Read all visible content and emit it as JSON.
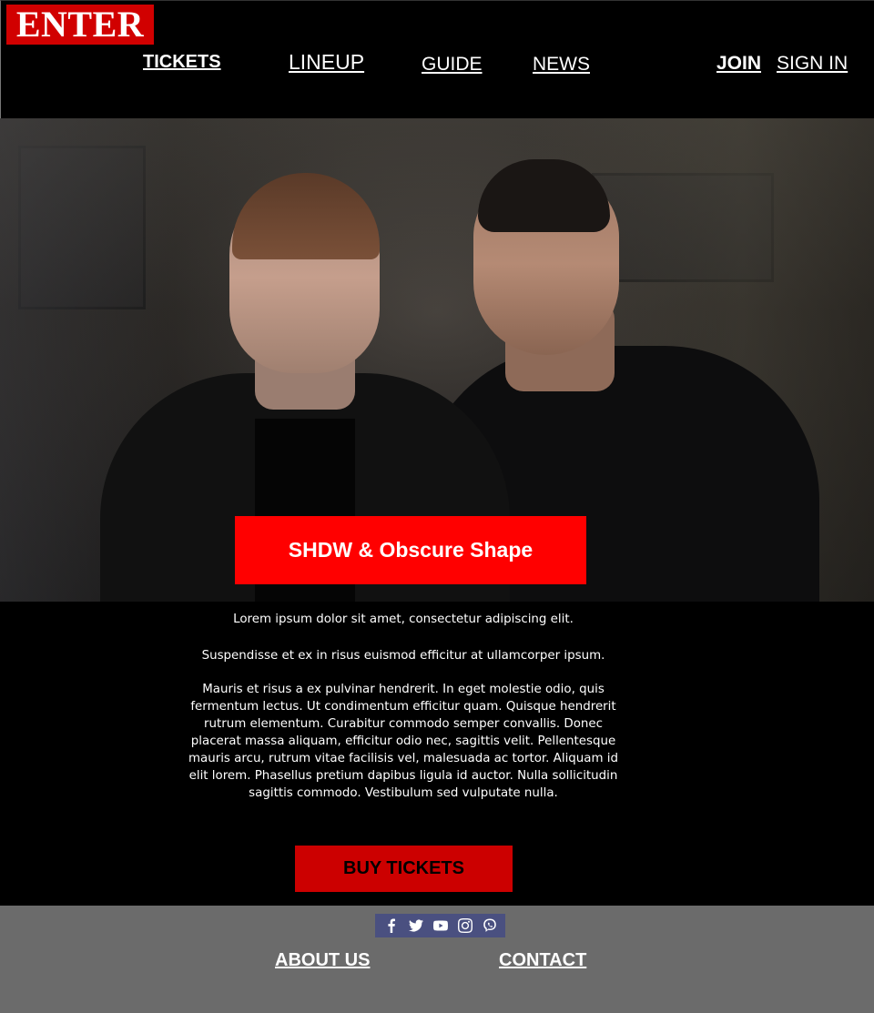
{
  "header": {
    "logo": "ENTER",
    "nav": {
      "tickets": "TICKETS",
      "lineup": "LINEUP",
      "guide": "GUIDE",
      "news": "NEWS"
    },
    "account": {
      "join": "JOIN",
      "sign_in": "SIGN IN"
    }
  },
  "hero": {
    "title": "SHDW & Obscure Shape"
  },
  "content": {
    "paragraphs": [
      "Lorem ipsum dolor sit amet, consectetur adipiscing elit.",
      "Suspendisse et ex in risus euismod efficitur at ullamcorper ipsum.",
      "Mauris et risus a ex pulvinar hendrerit. In eget molestie odio, quis fermentum lectus. Ut condimentum efficitur quam. Quisque hendrerit rutrum elementum. Curabitur commodo semper convallis. Donec placerat massa aliquam, efficitur odio nec, sagittis velit. Pellentesque mauris arcu, rutrum vitae facilisis vel, malesuada ac tortor. Aliquam id elit lorem. Phasellus pretium dapibus ligula id auctor. Nulla sollicitudin sagittis commodo. Vestibulum sed vulputate nulla."
    ],
    "buy_button": "BUY TICKETS"
  },
  "footer": {
    "social_icons": [
      "facebook-icon",
      "twitter-icon",
      "youtube-icon",
      "instagram-icon",
      "viber-icon"
    ],
    "about": "ABOUT US",
    "contact": "CONTACT"
  },
  "colors": {
    "brand_red": "#ff0000",
    "logo_red": "#d10000",
    "button_red": "#cc0000",
    "footer_gray": "#6b6b6b",
    "social_bar": "#4a5080"
  }
}
